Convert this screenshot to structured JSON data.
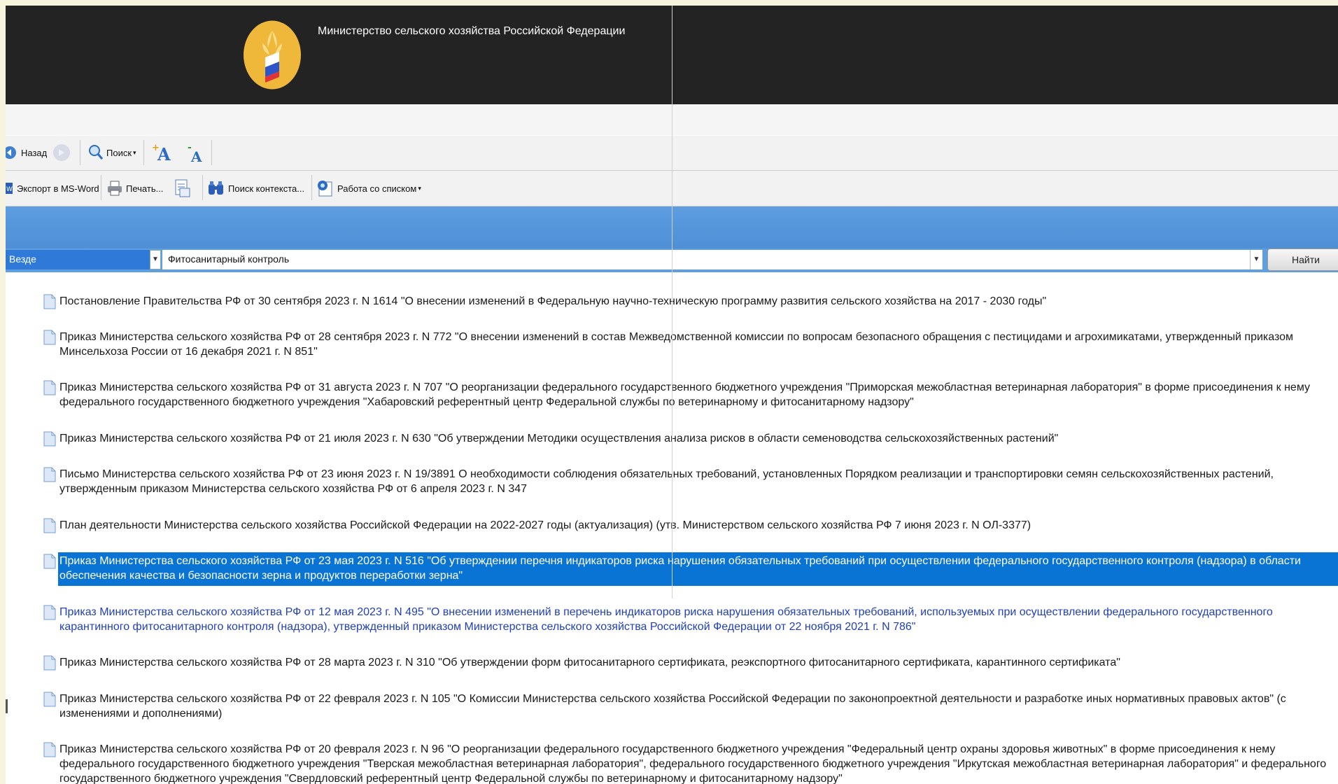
{
  "header": {
    "title": "Министерство сельского хозяйства Российской Федерации"
  },
  "toolbar1": {
    "back_label": "Назад",
    "search_label": "Поиск"
  },
  "toolbar2": {
    "export_label": "Экспорт в MS-Word",
    "print_label": "Печать...",
    "context_search_label": "Поиск контекста...",
    "list_label": "Работа со списком"
  },
  "search": {
    "scope": "Везде",
    "query": "Фитосанитарный контроль",
    "find_button": "Найти"
  },
  "results": [
    {
      "text": "Постановление Правительства РФ от 30 сентября 2023 г. N 1614 \"О внесении изменений в Федеральную научно-техническую программу развития сельского хозяйства на 2017 - 2030 годы\""
    },
    {
      "text": "Приказ Министерства сельского хозяйства РФ от 28 сентября 2023 г. N 772 \"О внесении изменений в состав Межведомственной комиссии по вопросам безопасного обращения с пестицидами и агрохимикатами, утвержденный приказом Минсельхоза России от 16 декабря 2021 г. N 851\""
    },
    {
      "text": "Приказ Министерства сельского хозяйства РФ от 31 августа 2023 г. N 707 \"О реорганизации федерального государственного бюджетного учреждения \"Приморская межобластная ветеринарная лаборатория\" в форме присоединения к нему федерального государственного бюджетного учреждения \"Хабаровский референтный центр Федеральной службы по ветеринарному и фитосанитарному надзору\""
    },
    {
      "text": "Приказ Министерства сельского хозяйства РФ от 21 июля 2023 г. N 630 \"Об утверждении Методики осуществления анализа рисков в области семеноводства сельскохозяйственных растений\""
    },
    {
      "text": "Письмо Министерства сельского хозяйства РФ от 23 июня 2023 г. N 19/3891 О необходимости соблюдения обязательных требований, установленных Порядком реализации и транспортировки семян сельскохозяйственных растений, утвержденным приказом Министерства сельского хозяйства РФ от 6 апреля 2023 г. N 347"
    },
    {
      "text": "План деятельности Министерства сельского хозяйства Российской Федерации на 2022-2027 годы (актуализация) (утв. Министерством сельского хозяйства РФ 7 июня 2023 г. N ОЛ-3377)"
    },
    {
      "text": "Приказ Министерства сельского хозяйства РФ от 23 мая 2023 г. N 516 \"Об утверждении перечня индикаторов риска нарушения обязательных требований при осуществлении федерального государственного контроля (надзора) в области обеспечения качества и безопасности зерна и продуктов переработки зерна\"",
      "selected": true
    },
    {
      "text": "Приказ Министерства сельского хозяйства РФ от 12 мая 2023 г. N 495 \"О внесении изменений в перечень индикаторов риска нарушения обязательных требований, используемых при осуществлении федерального государственного карантинного фитосанитарного контроля (надзора), утвержденный приказом Министерства сельского хозяйства Российской Федерации от 22 ноября 2021 г. N 786\"",
      "visited": true
    },
    {
      "text": "Приказ Министерства сельского хозяйства РФ от 28 марта 2023 г. N 310 \"Об утверждении форм фитосанитарного сертификата, реэкспортного фитосанитарного сертификата, карантинного сертификата\""
    },
    {
      "text": "Приказ Министерства сельского хозяйства РФ от 22 февраля 2023 г. N 105 \"О Комиссии Министерства сельского хозяйства Российской Федерации по законопроектной деятельности и разработке иных нормативных правовых актов\" (с изменениями и дополнениями)"
    },
    {
      "text": "Приказ Министерства сельского хозяйства РФ от 20 февраля 2023 г. N 96 \"О реорганизации федерального государственного бюджетного учреждения \"Федеральный центр охраны здоровья животных\" в форме присоединения к нему федерального государственного бюджетного учреждения \"Тверская межобластная ветеринарная лаборатория\", федерального государственного бюджетного учреждения \"Иркутская межобластная ветеринарная лаборатория\" и федерального государственного бюджетного учреждения \"Свердловский референтный центр Федеральной службы по ветеринарному и фитосанитарному надзору\""
    }
  ],
  "colors": {
    "header_bg": "#232323",
    "selection": "#0a74d4",
    "visited_link": "#2240b8",
    "logo_gold": "#f0b83a"
  }
}
